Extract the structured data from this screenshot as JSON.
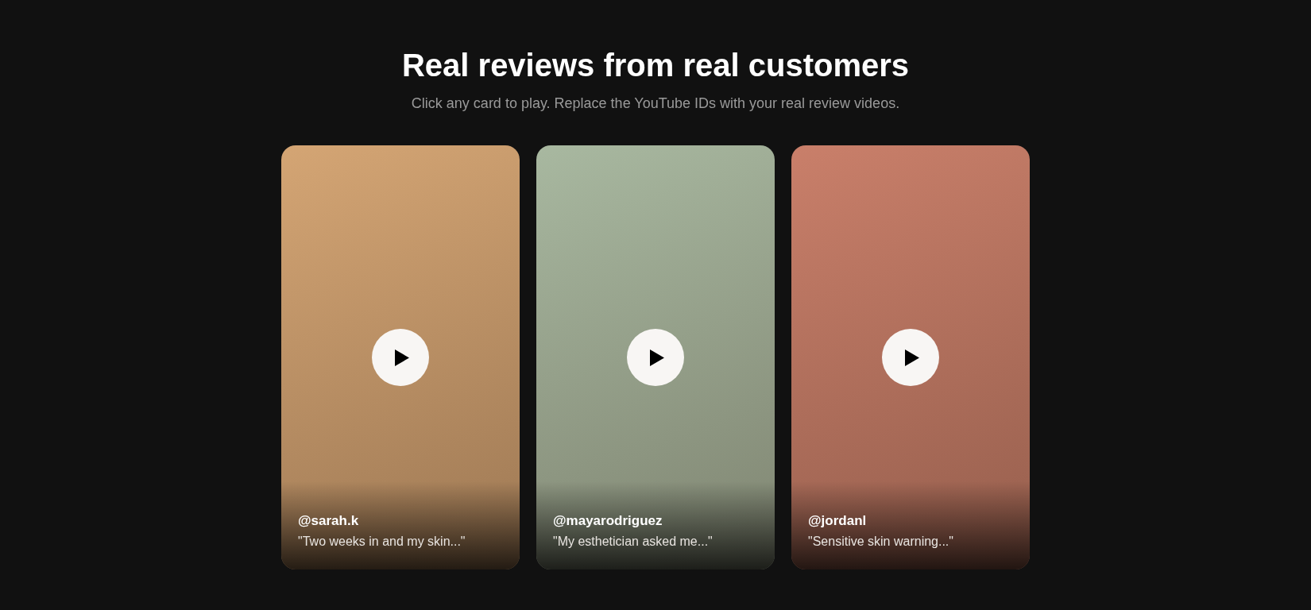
{
  "heading": {
    "title": "Real reviews from real customers",
    "subtitle": "Click any card to play. Replace the YouTube IDs with your real review videos."
  },
  "cards": [
    {
      "color": "#d4a574",
      "handle": "@sarah.k",
      "quote": "\"Two weeks in and my skin...\""
    },
    {
      "color": "#a8b8a0",
      "handle": "@mayarodriguez",
      "quote": "\"My esthetician asked me...\""
    },
    {
      "color": "#c97f6a",
      "handle": "@jordanl",
      "quote": "\"Sensitive skin warning...\""
    }
  ]
}
